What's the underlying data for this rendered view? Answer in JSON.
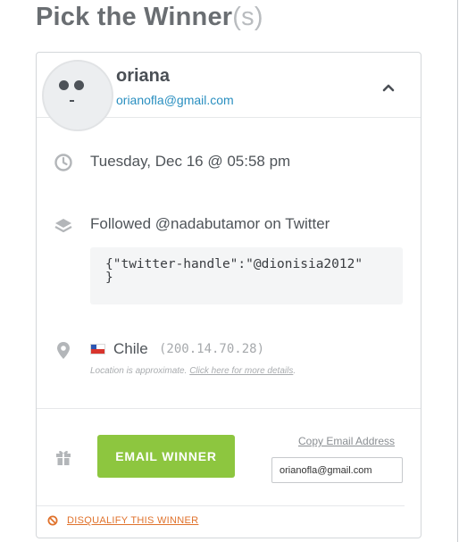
{
  "page": {
    "title_main": "Pick the Winner",
    "title_suffix": "(s)"
  },
  "entrant": {
    "name": "oriana",
    "email": "orianofla@gmail.com",
    "date": "Tuesday, Dec 16 @ 05:58 pm",
    "action": "Followed @nadabutamor on Twitter",
    "action_data_line1": "{\"twitter-handle\":\"@dionisia2012\"",
    "action_data_line2": "}",
    "country": "Chile",
    "ip": "(200.14.70.28)",
    "location_note": "Location is approximate.",
    "location_link": "Click here for more details",
    "location_link_suffix": "."
  },
  "actions": {
    "email_winner_label": "EMAIL WINNER",
    "copy_email_label": "Copy Email Address",
    "email_field_value": "orianofla@gmail.com",
    "disqualify_label": "DISQUALIFY THIS WINNER"
  },
  "icons": {
    "expand_toggle": "chevron-up-icon",
    "date": "clock-icon",
    "action": "layers-icon",
    "location": "map-pin-icon",
    "country_flag": "chile-flag-icon",
    "prize": "gift-icon",
    "disqualify": "prohibited-icon"
  },
  "colors": {
    "accent_link": "#2a8fc0",
    "email_button": "#8dc63f",
    "disqualify": "#e0722c",
    "icon_gray": "#b3b6b9"
  }
}
